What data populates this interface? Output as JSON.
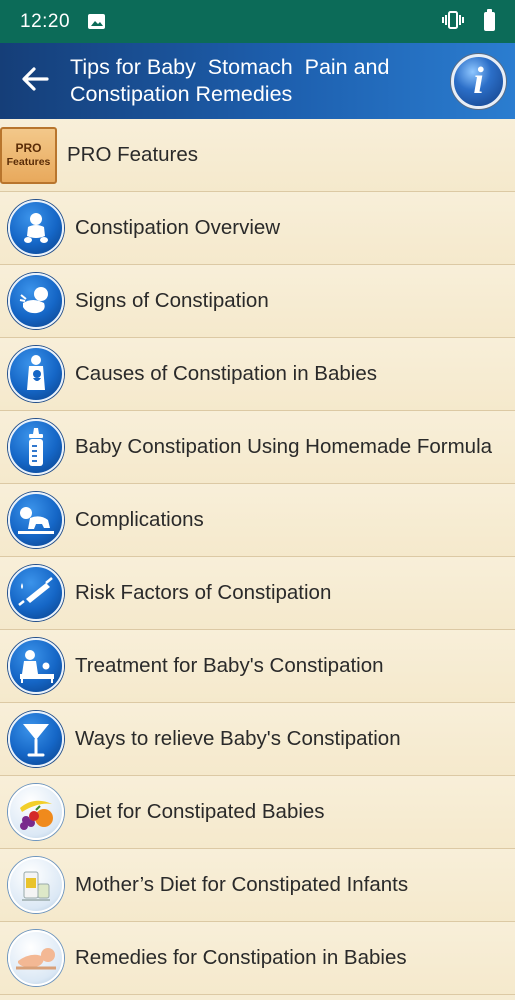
{
  "status_bar": {
    "time": "12:20",
    "icons": [
      "photo-icon",
      "vibrate-icon",
      "battery-icon"
    ]
  },
  "app_bar": {
    "title": "Tips for Baby  Stomach  Pain and\nConstipation Remedies",
    "back_icon": "arrow-left-icon",
    "info_label": "i"
  },
  "pro_badge": {
    "line1": "PRO",
    "line2": "Features"
  },
  "items": [
    {
      "label": "PRO Features",
      "icon": "pro-features-badge"
    },
    {
      "label": "Constipation Overview",
      "icon": "baby-sitting-icon"
    },
    {
      "label": "Signs of Constipation",
      "icon": "baby-crying-icon"
    },
    {
      "label": "Causes of Constipation in Babies",
      "icon": "mother-baby-icon"
    },
    {
      "label": "Baby Constipation Using Homemade Formula",
      "icon": "baby-bottle-icon"
    },
    {
      "label": "Complications",
      "icon": "baby-crawling-icon"
    },
    {
      "label": "Risk Factors of Constipation",
      "icon": "syringe-icon"
    },
    {
      "label": "Treatment for Baby's Constipation",
      "icon": "doctor-patient-icon"
    },
    {
      "label": "Ways to relieve Baby's Constipation",
      "icon": "glass-icon"
    },
    {
      "label": "Diet for Constipated Babies",
      "icon": "fruits-icon"
    },
    {
      "label": "Mother’s Diet for Constipated Infants",
      "icon": "baby-food-icon"
    },
    {
      "label": "Remedies for Constipation in Babies",
      "icon": "baby-massage-icon"
    }
  ]
}
